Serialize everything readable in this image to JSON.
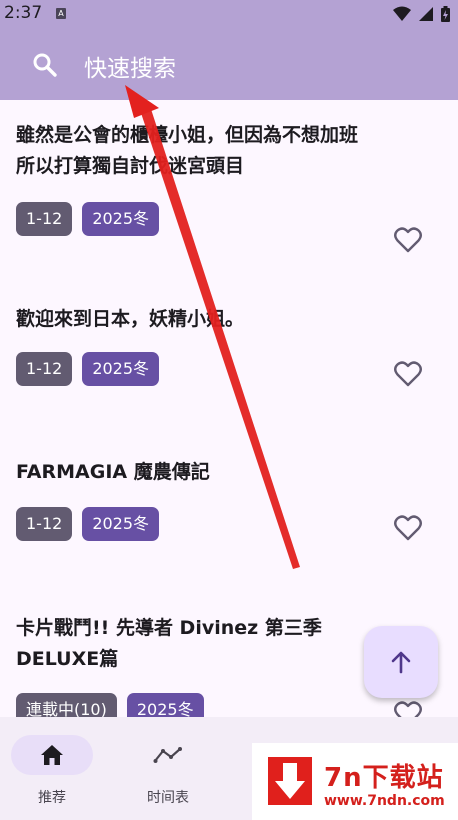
{
  "status_bar": {
    "time": "2:37",
    "notification_icon_letter": "A"
  },
  "search": {
    "placeholder": "快速搜索"
  },
  "items": [
    {
      "title": "雖然是公會的櫃檯小姐，但因為不想加班\n所以打算獨自討伐迷宮頭目",
      "episodes": "1-12",
      "season": "2025冬"
    },
    {
      "title": "歡迎來到日本，妖精小姐。",
      "episodes": "1-12",
      "season": "2025冬"
    },
    {
      "title": "FARMAGIA 魔農傳記",
      "episodes": "1-12",
      "season": "2025冬"
    },
    {
      "title": "卡片戰鬥!! 先導者 Divinez 第三季\nDELUXE篇",
      "episodes": "連載中(10)",
      "season": "2025冬"
    }
  ],
  "bottom_nav": {
    "items": [
      {
        "label": "推荐",
        "icon": "home-icon",
        "active": true
      },
      {
        "label": "时间表",
        "icon": "timeline-icon",
        "active": false
      }
    ]
  },
  "watermark": {
    "title": "7n下载站",
    "url": "www.7ndn.com"
  },
  "colors": {
    "header": "#b4a2d3",
    "episode_tag": "#625b71",
    "season_tag": "#6750a4",
    "annotation_arrow": "#e3211f"
  }
}
